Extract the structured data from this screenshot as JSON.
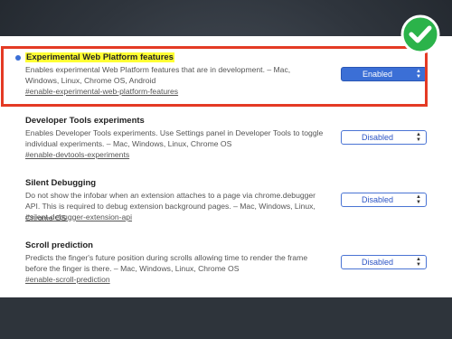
{
  "features": [
    {
      "title": "Experimental Web Platform features",
      "description": "Enables experimental Web Platform features that are in development. – Mac, Windows, Linux, Chrome OS, Android",
      "link": "#enable-experimental-web-platform-features",
      "value": "Enabled"
    },
    {
      "title": "Developer Tools experiments",
      "description": "Enables Developer Tools experiments. Use Settings panel in Developer Tools to toggle individual experiments. – Mac, Windows, Linux, Chrome OS",
      "link": "#enable-devtools-experiments",
      "value": "Disabled"
    },
    {
      "title": "Silent Debugging",
      "description": "Do not show the infobar when an extension attaches to a page via chrome.debugger API. This is required to debug extension background pages. – Mac, Windows, Linux, Chrome OS",
      "link": "#silent-debugger-extension-api",
      "value": "Disabled"
    },
    {
      "title": "Scroll prediction",
      "description": "Predicts the finger's future position during scrolls allowing time to render the frame before the finger is there. – Mac, Windows, Linux, Chrome OS",
      "link": "#enable-scroll-prediction",
      "value": "Disabled"
    }
  ],
  "colors": {
    "highlight": "#ffff33",
    "annotation_box": "#e43a24",
    "check_badge": "#2bb34a",
    "select_accent": "#3b6fd6"
  },
  "icons": {
    "badge": "checkmark-icon",
    "dropdown_arrow": "up-down-arrows-icon",
    "modified_indicator": "blue-dot-icon"
  }
}
